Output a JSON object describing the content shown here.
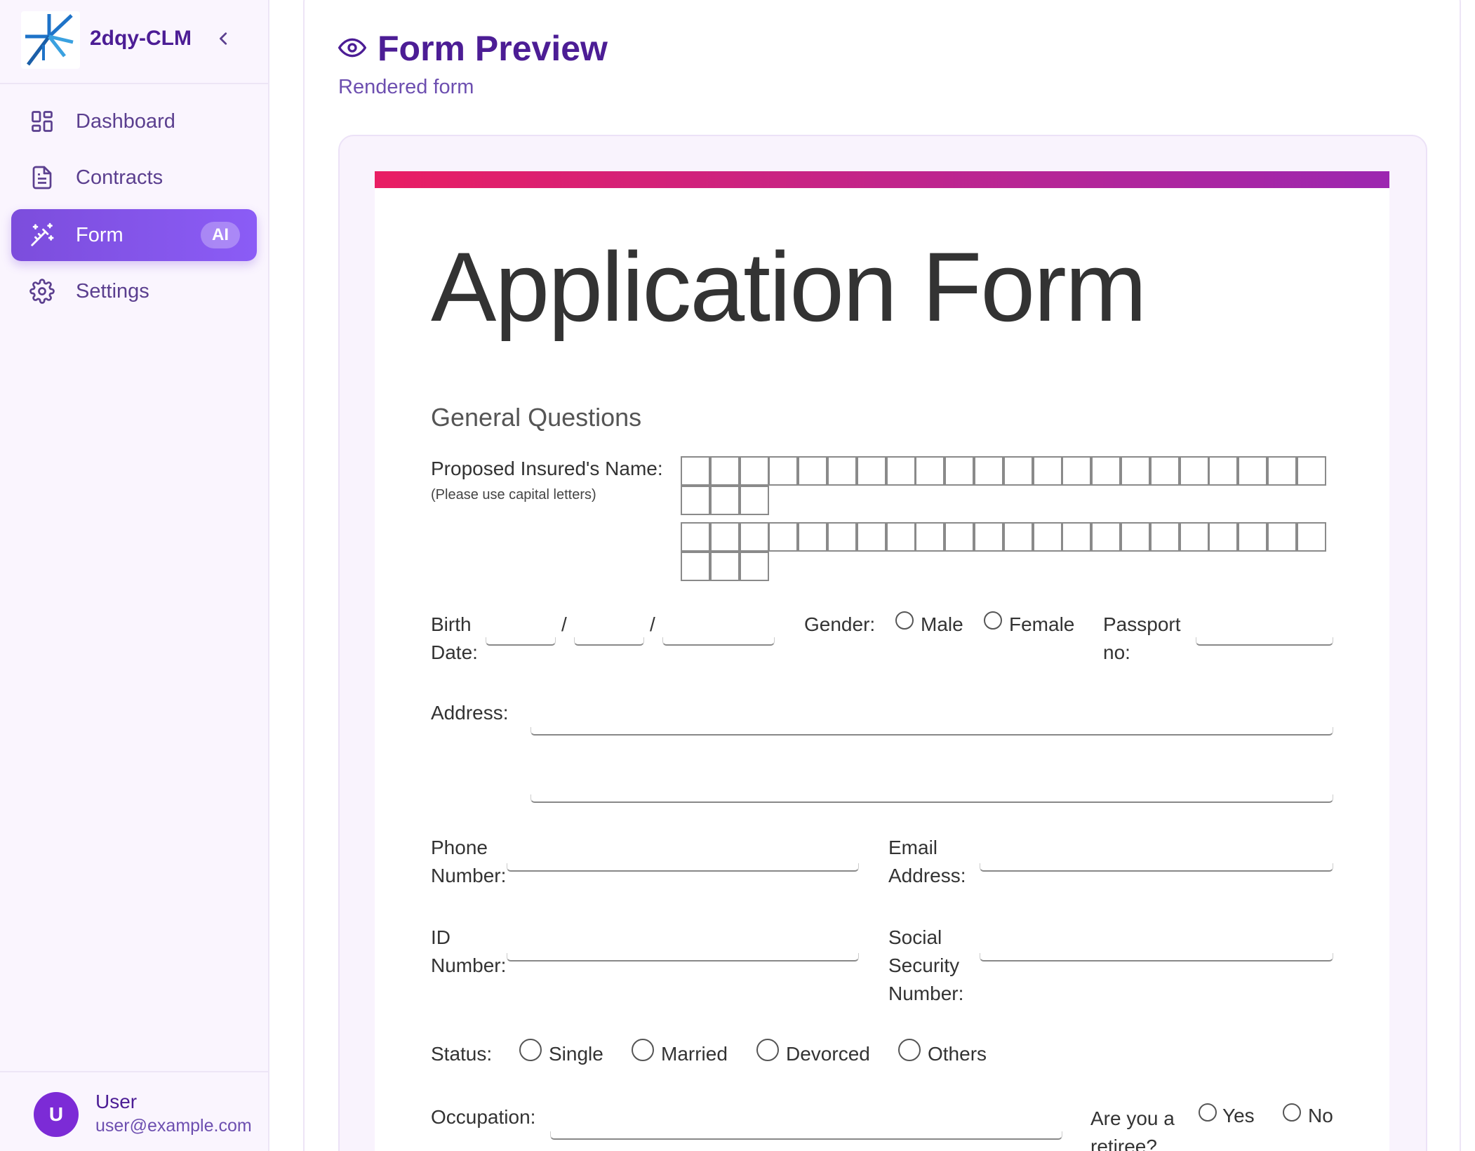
{
  "sidebar": {
    "brand_name": "2dqy-CLM",
    "items": [
      {
        "label": "Dashboard",
        "icon": "dashboard-icon"
      },
      {
        "label": "Contracts",
        "icon": "document-icon"
      },
      {
        "label": "Form",
        "icon": "magic-wand-icon",
        "badge": "AI",
        "active": true
      },
      {
        "label": "Settings",
        "icon": "gear-icon"
      }
    ],
    "user": {
      "initial": "U",
      "name": "User",
      "email": "user@example.com"
    }
  },
  "header": {
    "title": "Form Preview",
    "subtitle": "Rendered form"
  },
  "form": {
    "title": "Application Form",
    "section": "General Questions",
    "name_label": "Proposed Insured's Name:",
    "name_note": "(Please use capital letters)",
    "birth_label_1": "Birth",
    "birth_label_2": "Date:",
    "date_sep": "/",
    "gender_label": "Gender:",
    "gender_options": [
      "Male",
      "Female"
    ],
    "passport_label_1": "Passport",
    "passport_label_2": "no:",
    "address_label": "Address:",
    "phone_label_1": "Phone",
    "phone_label_2": "Number:",
    "email_label_1": "Email",
    "email_label_2": "Address:",
    "id_label_1": "ID",
    "id_label_2": "Number:",
    "ssn_label_1": "Social",
    "ssn_label_2": "Security",
    "ssn_label_3": "Number:",
    "status_label": "Status:",
    "status_options": [
      "Single",
      "Married",
      "Devorced",
      "Others"
    ],
    "occupation_label": "Occupation:",
    "retiree_label_1": "Are you a",
    "retiree_label_2": "retiree?",
    "retiree_options": [
      "Yes",
      "No"
    ]
  },
  "colors": {
    "accent": "#7c4ddc",
    "brand_text": "#4c1d95",
    "form_bar_start": "#e91e63",
    "form_bar_end": "#9c27b0"
  }
}
